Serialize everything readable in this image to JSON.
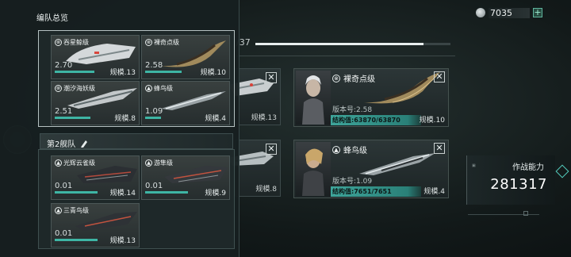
{
  "background": {
    "progress": {
      "text": "/37",
      "fill_fraction": 0.86
    },
    "cards": [
      {
        "scale": "规模.13"
      },
      {
        "scale": "规模.8"
      }
    ],
    "detail_cards": [
      {
        "name": "裸奇点级",
        "version": "版本号:2.58",
        "structure": "结构值:63870/63870",
        "scale": "规模.10",
        "type_icon": "target-icon"
      },
      {
        "name": "蜂鸟级",
        "version": "版本号:1.09",
        "structure": "结构值:7651/7651",
        "scale": "规模.4",
        "type_icon": "warning-icon"
      }
    ]
  },
  "currency": {
    "amount": "7035",
    "plus": "+"
  },
  "combat_power": {
    "label": "作战能力",
    "value": "281317"
  },
  "overview": {
    "title": "编队总览",
    "fleet1": {
      "ships": [
        {
          "name": "吞星鲸级",
          "value": "2.70",
          "scale": "规模.13",
          "icon": "target-icon"
        },
        {
          "name": "裸奇点级",
          "value": "2.58",
          "scale": "规模.10",
          "icon": "target-icon"
        },
        {
          "name": "潮汐海妖级",
          "value": "2.51",
          "scale": "规模.8",
          "icon": "target-icon"
        },
        {
          "name": "蜂鸟级",
          "value": "1.09",
          "scale": "规模.4",
          "icon": "warning-icon"
        }
      ]
    },
    "fleet2": {
      "title": "第2舰队",
      "ships": [
        {
          "name": "光辉云雀级",
          "value": "0.01",
          "scale": "规模.14",
          "icon": "warning-icon"
        },
        {
          "name": "游隼级",
          "value": "0.01",
          "scale": "规模.9",
          "icon": "warning-icon"
        },
        {
          "name": "三青鸟级",
          "value": "0.01",
          "scale": "规模.13",
          "icon": "warning-icon"
        }
      ]
    }
  },
  "colors": {
    "accent": "#3eb5a4",
    "panel": "#1d2526",
    "highlight": "#54d1c1"
  }
}
